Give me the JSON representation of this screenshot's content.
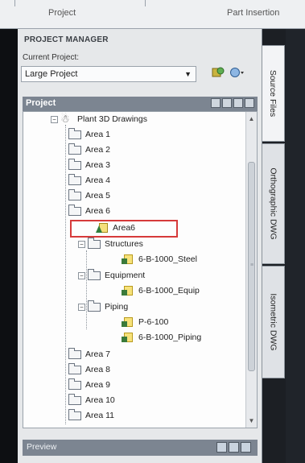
{
  "ribbon": {
    "tabs": [
      "Project",
      "Part Insertion"
    ]
  },
  "panel": {
    "title": "PROJECT MANAGER",
    "current_project_label": "Current Project:",
    "current_project_value": "Large Project",
    "tree_header": "Project",
    "preview_label": "Preview"
  },
  "tree": {
    "root": "Plant 3D Drawings",
    "areas_top": [
      "Area 1",
      "Area 2",
      "Area 3",
      "Area 4",
      "Area 5",
      "Area 6"
    ],
    "selected": "Area6",
    "structures": {
      "label": "Structures",
      "children": [
        "6-B-1000_Steel"
      ]
    },
    "equipment": {
      "label": "Equipment",
      "children": [
        "6-B-1000_Equip"
      ]
    },
    "piping": {
      "label": "Piping",
      "children": [
        "P-6-100",
        "6-B-1000_Piping"
      ]
    },
    "areas_bottom": [
      "Area 7",
      "Area 8",
      "Area 9",
      "Area 10",
      "Area 11"
    ]
  },
  "vertical_tabs": [
    "Source Files",
    "Orthographic DWG",
    "Isometric DWG"
  ],
  "colors": {
    "highlight": "#d63a3a",
    "header": "#7c8591"
  }
}
